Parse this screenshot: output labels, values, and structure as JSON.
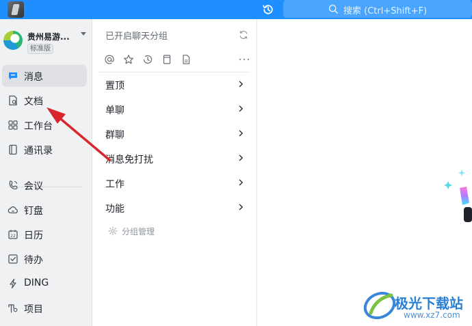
{
  "topbar": {
    "search_placeholder": "搜索 (Ctrl+Shift+F)",
    "accent_color": "#1f8fff"
  },
  "org": {
    "name": "贵州易游...",
    "badge": "标准版"
  },
  "sidebar": {
    "items": [
      {
        "label": "消息",
        "icon": "message-icon",
        "active": true
      },
      {
        "label": "文档",
        "icon": "document-icon",
        "active": false
      },
      {
        "label": "工作台",
        "icon": "workbench-grid-icon",
        "active": false
      },
      {
        "label": "通讯录",
        "icon": "contacts-icon",
        "active": false
      },
      {
        "label": "会议",
        "icon": "phone-meeting-icon",
        "active": false
      },
      {
        "label": "钉盘",
        "icon": "cloud-drive-icon",
        "active": false
      },
      {
        "label": "日历",
        "icon": "calendar-icon",
        "active": false
      },
      {
        "label": "待办",
        "icon": "todo-check-icon",
        "active": false
      },
      {
        "label": "DING",
        "icon": "lightning-icon",
        "active": false
      },
      {
        "label": "项目",
        "icon": "project-icon",
        "active": false
      }
    ],
    "calendar_day": "22"
  },
  "middle": {
    "title": "已开启聊天分组",
    "filter_icons": [
      "at-icon",
      "star-icon",
      "clock-icon",
      "bookmark-icon",
      "file-icon"
    ],
    "groups": [
      {
        "label": "置顶"
      },
      {
        "label": "单聊"
      },
      {
        "label": "群聊"
      },
      {
        "label": "消息免打扰"
      },
      {
        "label": "工作"
      },
      {
        "label": "功能"
      }
    ],
    "manage_label": "分组管理"
  },
  "watermark": {
    "name": "极光下载站",
    "url": "www.xz7.com"
  },
  "colors": {
    "sidebar_bg": "#f0f1f3",
    "active_item_bg": "#dfe1e5",
    "arrow": "#d9262c"
  }
}
